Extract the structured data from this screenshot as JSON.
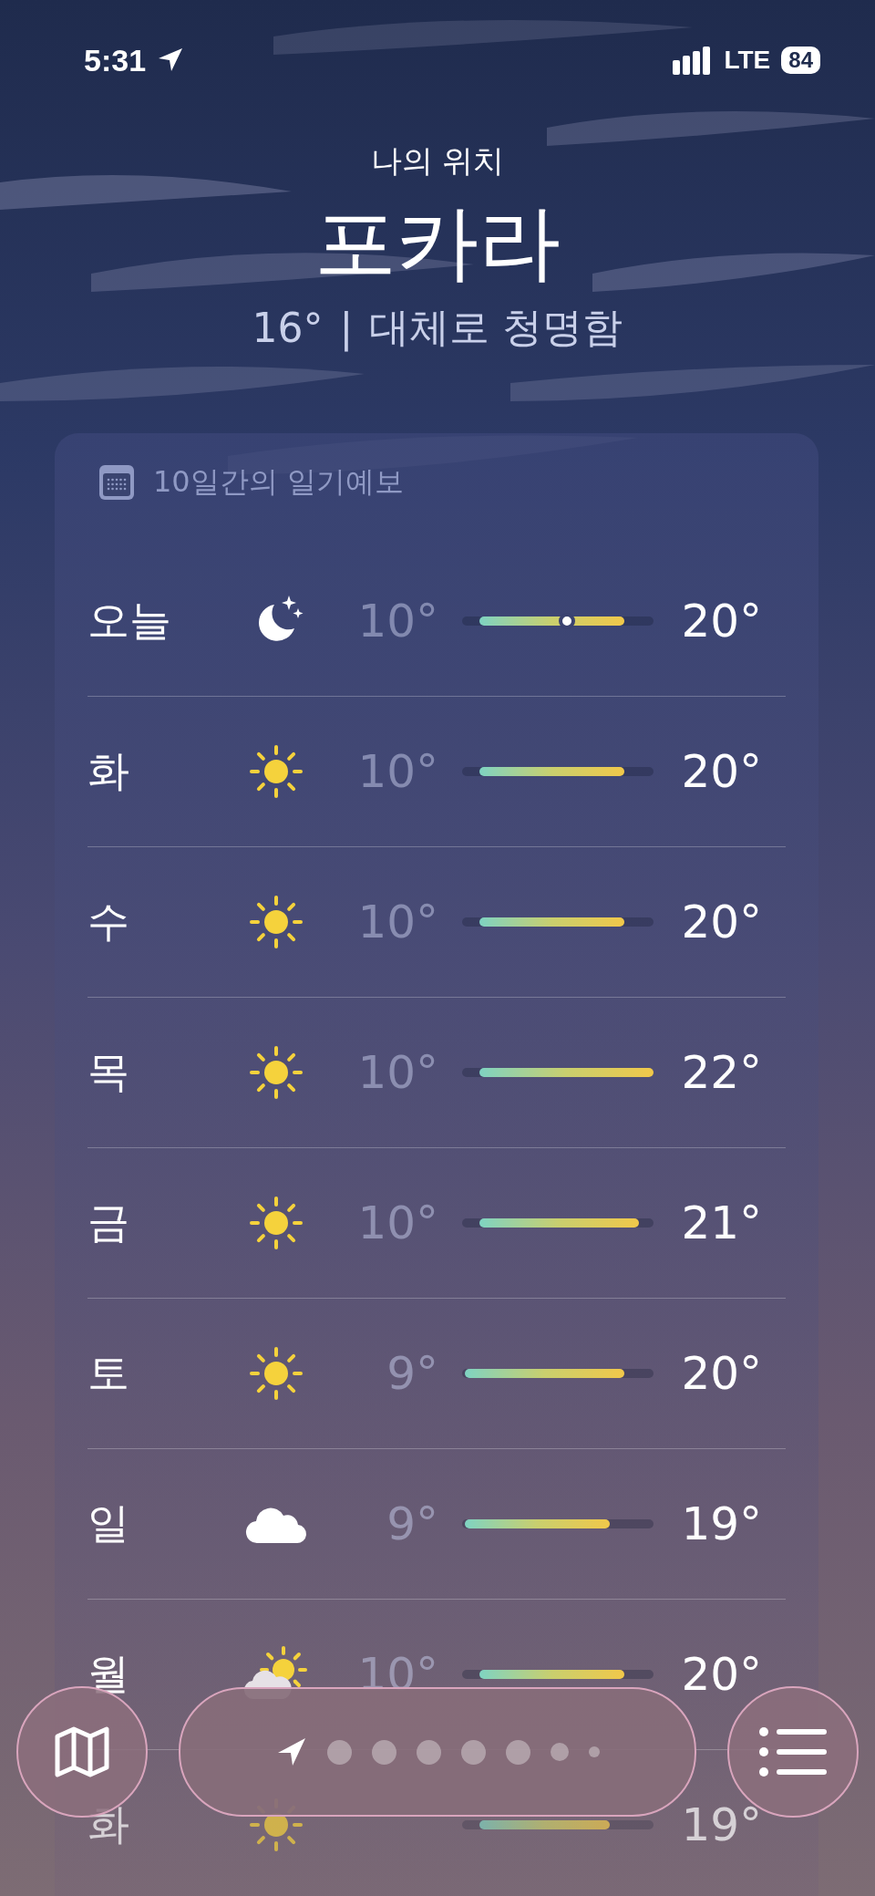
{
  "status_bar": {
    "time": "5:31",
    "network": "LTE",
    "battery": "84"
  },
  "location": {
    "label": "나의 위치",
    "city": "포카라",
    "temperature": "16°",
    "separator": "|",
    "condition": "대체로 청명함"
  },
  "forecast": {
    "title": "10일간의 일기예보",
    "days": [
      {
        "day": "오늘",
        "kind": "moon",
        "low": "10°",
        "high": "20°",
        "current": true
      },
      {
        "day": "화",
        "kind": "sun",
        "low": "10°",
        "high": "20°",
        "current": false
      },
      {
        "day": "수",
        "kind": "sun",
        "low": "10°",
        "high": "20°",
        "current": false
      },
      {
        "day": "목",
        "kind": "sun",
        "low": "10°",
        "high": "22°",
        "current": false
      },
      {
        "day": "금",
        "kind": "sun",
        "low": "10°",
        "high": "21°",
        "current": false
      },
      {
        "day": "토",
        "kind": "sun",
        "low": "9°",
        "high": "20°",
        "current": false
      },
      {
        "day": "일",
        "kind": "cloud",
        "low": "9°",
        "high": "19°",
        "current": false
      },
      {
        "day": "월",
        "kind": "sun-cloud",
        "low": "10°",
        "high": "20°",
        "current": false
      },
      {
        "day": "화",
        "kind": "sun",
        "high": "19°",
        "current": false
      }
    ]
  },
  "pages": [
    {
      "kind": "location",
      "selected": true
    },
    {
      "kind": "dot",
      "selected": false
    },
    {
      "kind": "dot",
      "selected": false
    },
    {
      "kind": "dot",
      "selected": false
    },
    {
      "kind": "dot",
      "selected": false
    },
    {
      "kind": "dot",
      "selected": false
    },
    {
      "kind": "small",
      "selected": false
    },
    {
      "kind": "tiny",
      "selected": false
    }
  ]
}
